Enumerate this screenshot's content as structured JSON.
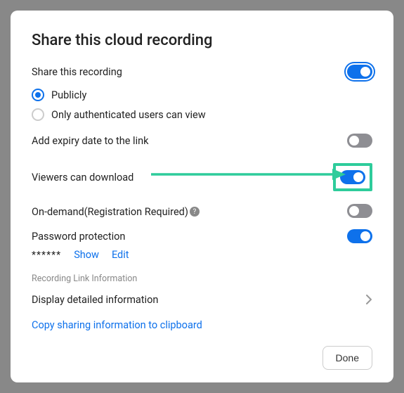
{
  "title": "Share this cloud recording",
  "share_recording": {
    "label": "Share this recording",
    "enabled": true,
    "options": {
      "publicly": "Publicly",
      "authenticated": "Only authenticated users can view",
      "selected": "publicly"
    }
  },
  "expiry": {
    "label": "Add expiry date to the link",
    "enabled": false
  },
  "download": {
    "label": "Viewers can download",
    "enabled": true
  },
  "ondemand": {
    "label": "On-demand(Registration Required)",
    "enabled": false
  },
  "password": {
    "label": "Password protection",
    "enabled": true,
    "masked_value": "******",
    "show_label": "Show",
    "edit_label": "Edit"
  },
  "link_info": {
    "section_label": "Recording Link Information",
    "display_label": "Display detailed information",
    "copy_label": "Copy sharing information to clipboard"
  },
  "footer": {
    "done_label": "Done"
  },
  "help_glyph": "?"
}
